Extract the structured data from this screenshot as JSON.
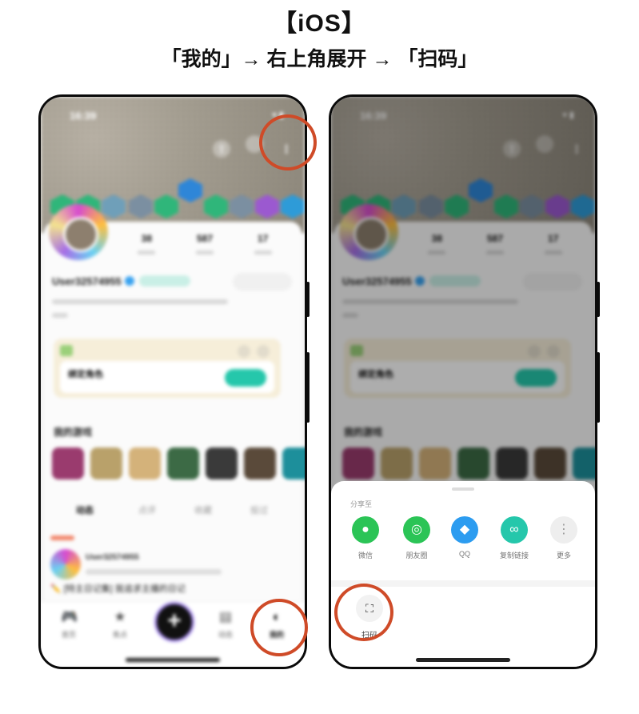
{
  "header": {
    "title": "【iOS】",
    "subtitle": "「我的」→ 右上角展开 → 「扫码」"
  },
  "phone": {
    "status_time": "16:39",
    "stats": [
      {
        "value": "38"
      },
      {
        "value": "587"
      },
      {
        "value": "17"
      }
    ],
    "username": "User32574955",
    "card_title": "绑定角色",
    "games_title": "我的游戏",
    "feed_tabs": [
      "动态",
      "点评",
      "收藏",
      "投过"
    ],
    "post_author": "User32574955",
    "post_title": "✏️ [特主日记集] 我追求主播的日记",
    "tabs": [
      {
        "label": "首页",
        "icon": "gamepad-icon"
      },
      {
        "label": "焦点",
        "icon": "star-icon"
      },
      {
        "label": "",
        "icon": "plus-icon"
      },
      {
        "label": "动态",
        "icon": "message-icon"
      },
      {
        "label": "我的",
        "icon": "profile-icon"
      }
    ]
  },
  "share_sheet": {
    "title": "分享至",
    "items": [
      {
        "label": "微信",
        "color": "#2bc456",
        "icon": "wechat-icon"
      },
      {
        "label": "朋友圈",
        "color": "#2bc456",
        "icon": "moments-icon"
      },
      {
        "label": "QQ",
        "color": "#2c9cf0",
        "icon": "qq-icon"
      },
      {
        "label": "复制链接",
        "color": "#25c7ab",
        "icon": "link-icon"
      },
      {
        "label": "更多",
        "color": "#eeeeee",
        "icon": "more-icon"
      }
    ],
    "scan_label": "扫码"
  },
  "glyphs": {
    "more": "⋮",
    "plus": "+",
    "scan": "⛶",
    "wifi": "▾ ▮",
    "gamepad": "🎮",
    "star": "★",
    "message": "▤",
    "profile": "◐",
    "share": "⇪"
  },
  "colors": {
    "highlight_ring": "#cf4b28",
    "accent_teal": "#25c7ab"
  }
}
